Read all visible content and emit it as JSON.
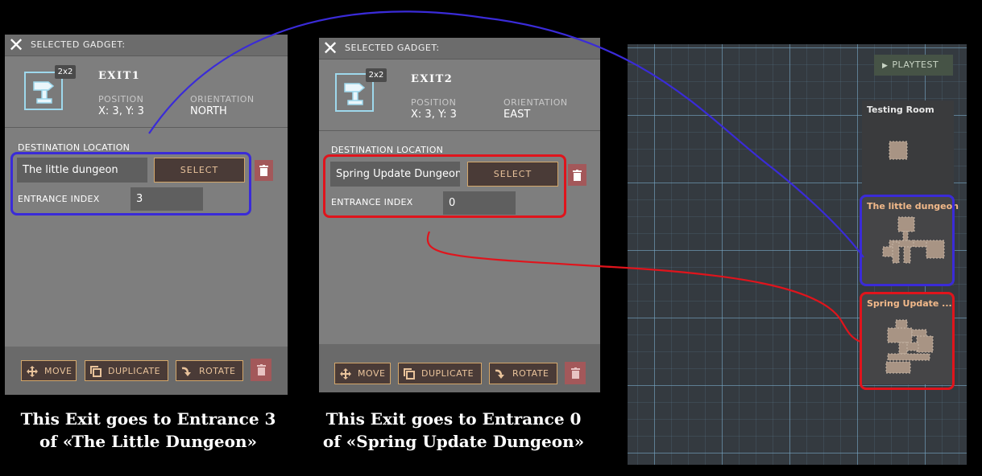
{
  "panel1": {
    "header": "SELECTED GADGET:",
    "size_badge": "2x2",
    "gadget_name": "EXIT1",
    "position_label": "POSITION",
    "position_value": "X: 3, Y: 3",
    "orientation_label": "ORIENTATION",
    "orientation_value": "NORTH",
    "destination_label": "DESTINATION LOCATION",
    "destination_value": "The little dungeon",
    "select_label": "SELECT",
    "entrance_label": "ENTRANCE INDEX",
    "entrance_value": "3",
    "move_label": "MOVE",
    "duplicate_label": "DUPLICATE",
    "rotate_label": "ROTATE",
    "highlight_color": "#3a2bd8"
  },
  "panel2": {
    "header": "SELECTED GADGET:",
    "size_badge": "2x2",
    "gadget_name": "EXIT2",
    "position_label": "POSITION",
    "position_value": "X: 3, Y: 3",
    "orientation_label": "ORIENTATION",
    "orientation_value": "EAST",
    "destination_label": "DESTINATION LOCATION",
    "destination_value": "Spring Update Dungeon",
    "select_label": "SELECT",
    "entrance_label": "ENTRANCE INDEX",
    "entrance_value": "0",
    "move_label": "MOVE",
    "duplicate_label": "DUPLICATE",
    "rotate_label": "ROTATE",
    "highlight_color": "#e0141c"
  },
  "captions": {
    "left_line1": "This Exit goes to Entrance 3",
    "left_line2": "of «The Little Dungeon»",
    "right_line1": "This Exit goes to Entrance 0",
    "right_line2": "of «Spring Update Dungeon»"
  },
  "map": {
    "playtest_label": "PLAYTEST",
    "rooms": [
      {
        "title": "Testing Room",
        "title_color": "#e8e8e8"
      },
      {
        "title": "The little dungeon",
        "title_color": "#f2b98a"
      },
      {
        "title": "Spring Update ...",
        "title_color": "#f2b98a"
      }
    ]
  },
  "colors": {
    "accent_border": "#d4a76a",
    "button_text": "#e9c39b",
    "trash_bg": "#a3585a",
    "room_tile": "#a89484"
  },
  "icons": {
    "close": "close-icon",
    "signpost": "signpost-icon",
    "trash": "trash-icon",
    "move": "move-arrows-icon",
    "duplicate": "duplicate-icon",
    "rotate": "rotate-arrow-icon",
    "play": "play-icon"
  }
}
